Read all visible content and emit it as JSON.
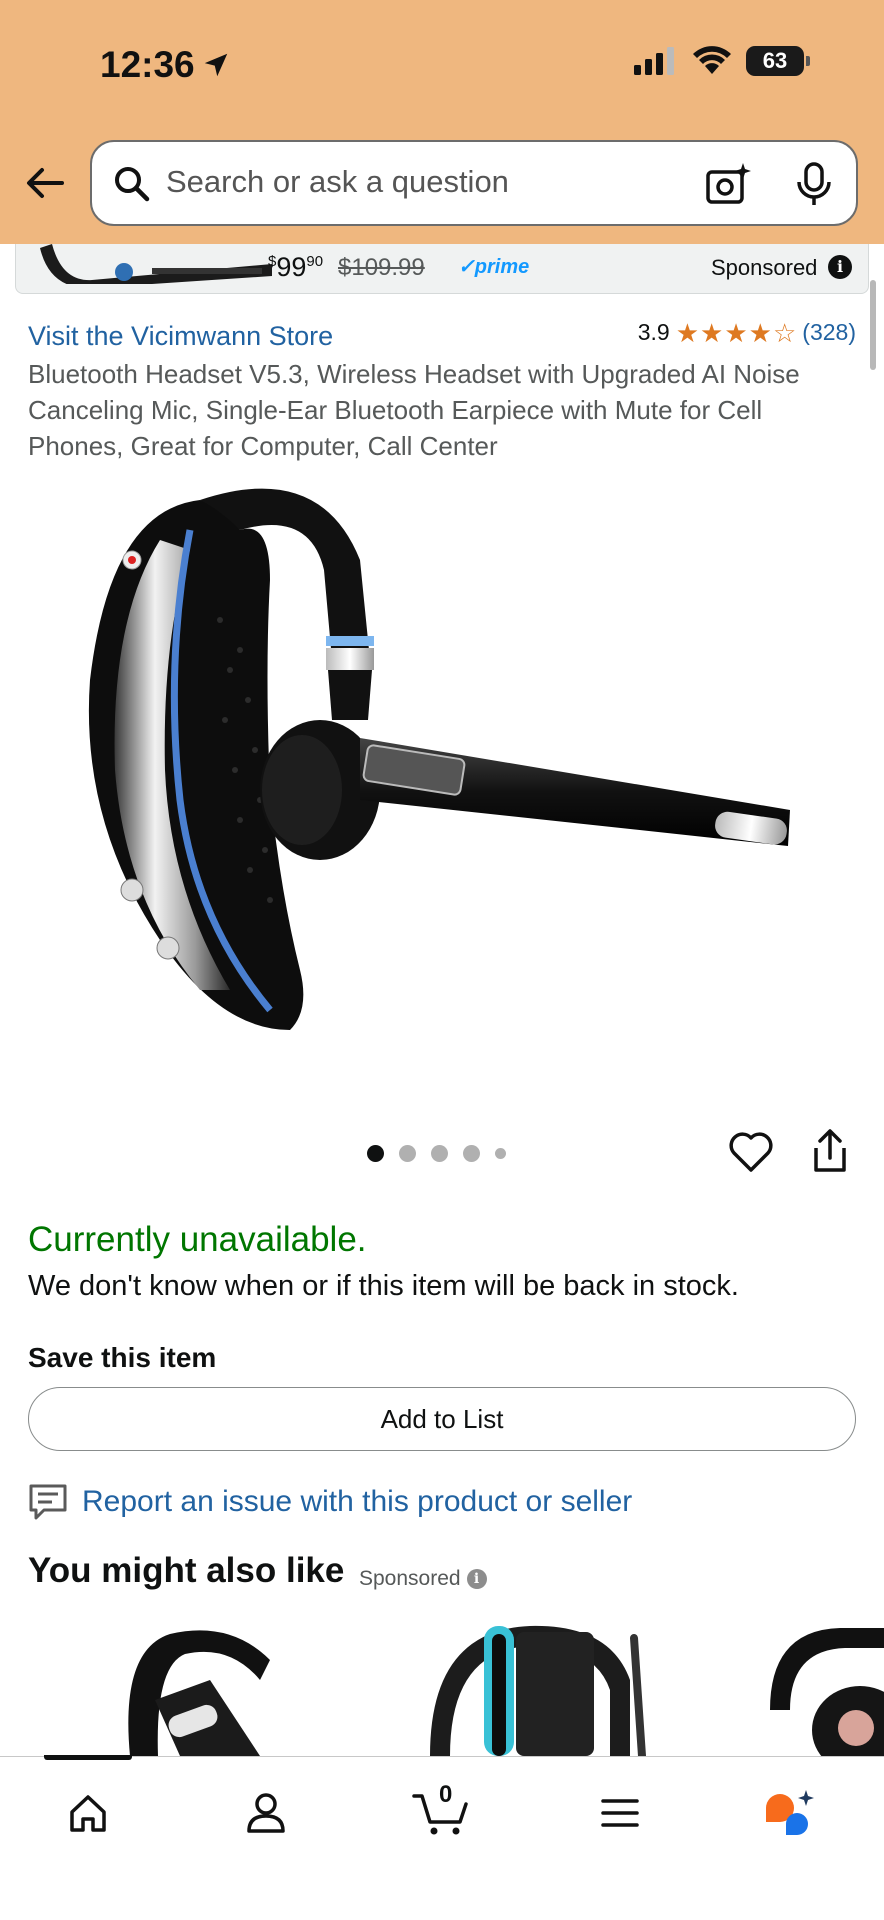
{
  "status_bar": {
    "time": "12:36",
    "battery": "63"
  },
  "search": {
    "placeholder": "Search or ask a question"
  },
  "sponsored_strip": {
    "price_whole": "99",
    "price_fraction": "90",
    "price_currency": "$",
    "list_price": "$109.99",
    "prime_label": "✓prime",
    "sponsored_label": "Sponsored"
  },
  "product": {
    "store_link": "Visit the Vicimwann Store",
    "rating": "3.9",
    "rating_fraction": 0.78,
    "review_count": "(328)",
    "title": "Bluetooth Headset V5.3, Wireless Headset with Upgraded AI Noise Canceling Mic, Single-Ear Bluetooth Earpiece with Mute for Cell Phones, Great for Computer, Call Center",
    "image_count": 5,
    "active_image": 1
  },
  "availability": {
    "status": "Currently unavailable.",
    "note": "We don't know when or if this item will be back in stock."
  },
  "save": {
    "heading": "Save this item",
    "add_to_list": "Add to List"
  },
  "report": {
    "link": "Report an issue with this product or seller"
  },
  "recommendations": {
    "heading": "You might also like",
    "sponsored_label": "Sponsored"
  },
  "bottom_nav": {
    "cart_count": "0",
    "items": [
      "home-icon",
      "account-icon",
      "cart-icon",
      "menu-icon",
      "rufus-icon"
    ]
  },
  "colors": {
    "header_bg": "#efb77f",
    "link": "#2162a1",
    "in_stock_green": "#007600",
    "star": "#de7921",
    "rufus_orange": "#f76b1c",
    "rufus_blue": "#1a73e8"
  }
}
